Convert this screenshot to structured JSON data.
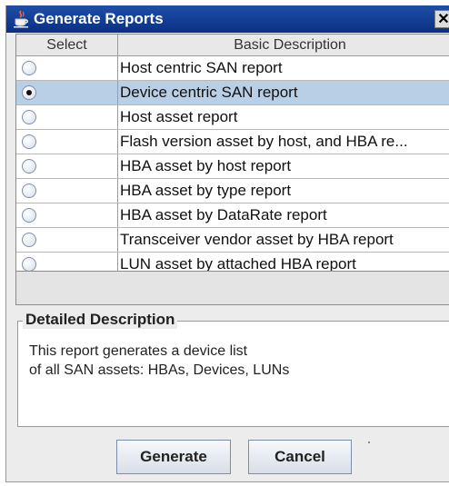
{
  "window": {
    "title": "Generate Reports",
    "close_label": "✕"
  },
  "table": {
    "columns": [
      "Select",
      "Basic Description"
    ],
    "rows": [
      {
        "description": "Host centric SAN report",
        "selected": false
      },
      {
        "description": "Device centric SAN report",
        "selected": true
      },
      {
        "description": "Host asset report",
        "selected": false
      },
      {
        "description": "Flash version asset by host, and HBA re...",
        "selected": false
      },
      {
        "description": "HBA asset by host report",
        "selected": false
      },
      {
        "description": "HBA asset by type report",
        "selected": false
      },
      {
        "description": "HBA asset by DataRate report",
        "selected": false
      },
      {
        "description": "Transceiver vendor asset by HBA report",
        "selected": false
      },
      {
        "description": "LUN asset by attached HBA report",
        "selected": false
      }
    ]
  },
  "details": {
    "legend": "Detailed Description",
    "line1": "This report generates a device list",
    "line2": "of all SAN assets:  HBAs, Devices, LUNs"
  },
  "buttons": {
    "generate": "Generate",
    "cancel": "Cancel"
  },
  "colors": {
    "titlebar": "#0a2f83",
    "selection": "#b8cfe5",
    "dialog_bg": "#ececec"
  },
  "icons": {
    "title": "java-coffee-cup-icon",
    "close": "close-icon",
    "radio": "radio-button-icon"
  }
}
